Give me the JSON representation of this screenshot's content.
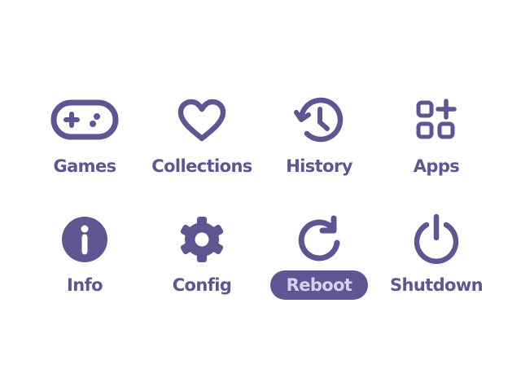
{
  "theme": {
    "accent": "#5f5592",
    "selected_text": "#d6d2ec",
    "background": "#ffffff"
  },
  "menu": {
    "selected": "Reboot",
    "items": [
      {
        "label": "Games",
        "icon": "gamepad-icon"
      },
      {
        "label": "Collections",
        "icon": "heart-icon"
      },
      {
        "label": "History",
        "icon": "history-icon"
      },
      {
        "label": "Apps",
        "icon": "apps-grid-icon"
      },
      {
        "label": "Info",
        "icon": "info-icon"
      },
      {
        "label": "Config",
        "icon": "gear-icon"
      },
      {
        "label": "Reboot",
        "icon": "reboot-icon"
      },
      {
        "label": "Shutdown",
        "icon": "power-icon"
      }
    ]
  }
}
